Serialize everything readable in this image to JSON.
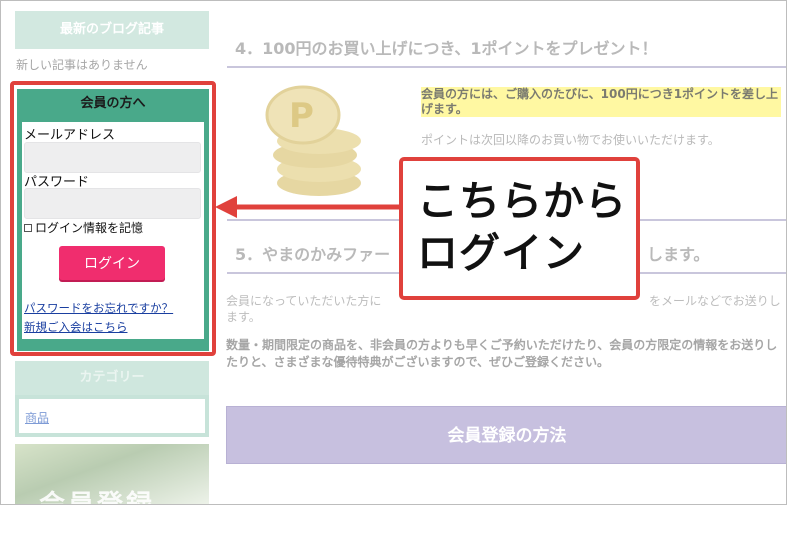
{
  "sidebar": {
    "blog_heading": "最新のブログ記事",
    "blog_empty": "新しい記事はありません",
    "login": {
      "title": "会員の方へ",
      "email_label": "メールアドレス",
      "password_label": "パスワード",
      "remember_label": "ログイン情報を記憶",
      "login_button": "ログイン",
      "forgot_link": "パスワードをお忘れですか？",
      "signup_link": "新規ご入会はこちら"
    },
    "category_heading": "カテゴリー",
    "category_item": "商品",
    "banner_text": "会員登録"
  },
  "main": {
    "section4_heading": "4．100円のお買い上げにつき、1ポイントをプレゼント！",
    "highlight_text": "会員の方には、ご購入のたびに、100円につき1ポイントを差し上げます。",
    "point_note": "ポイントは次回以降のお買い物でお使いいただけます。",
    "section5_heading_start": "5．やまのかみファー",
    "section5_heading_end": "します。",
    "para1_start": "会員になっていただいた方に",
    "para1_end": "をメールなどでお送りし",
    "para1_tail": "ます。",
    "para2": "数量・期間限定の商品を、非会員の方よりも早くご予約いただけたり、会員の方限定の情報をお送りしたりと、さまざまな優待特典がございますので、ぜひご登録ください。",
    "register_bar": "会員登録の方法"
  },
  "callout": {
    "line1": "こちらから",
    "line2": "ログイン"
  },
  "colors": {
    "accent_red": "#e0413c",
    "login_green": "#49a98a",
    "login_button": "#f02d6e",
    "register_bar": "#c7c0df"
  }
}
